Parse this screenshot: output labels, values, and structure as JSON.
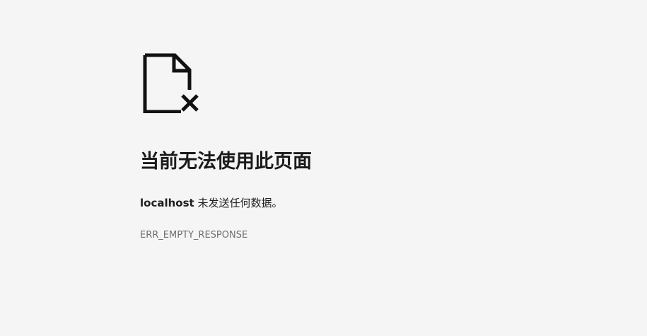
{
  "icon": "broken-file-icon",
  "title": "当前无法使用此页面",
  "message": {
    "host": "localhost",
    "text": " 未发送任何数据。"
  },
  "error_code": "ERR_EMPTY_RESPONSE",
  "colors": {
    "background": "#f5f5f5",
    "text": "#1b1b1b",
    "secondary_text": "#6e6e6e"
  }
}
